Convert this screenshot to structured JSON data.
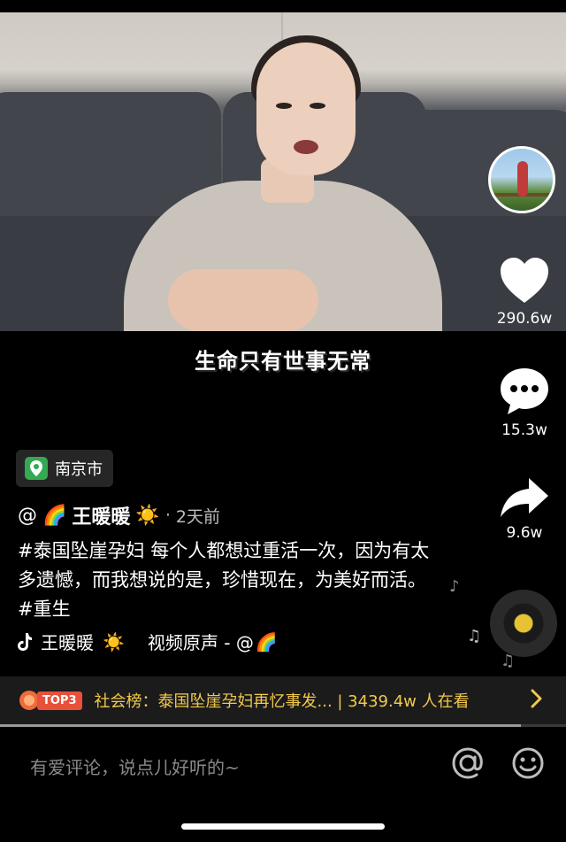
{
  "video": {
    "subtitle": "生命只有世事无常"
  },
  "sidebar": {
    "likes": "290.6w",
    "comments": "15.3w",
    "shares": "9.6w"
  },
  "location": {
    "label": "南京市"
  },
  "post": {
    "author_prefix": "@",
    "author_emoji_before": "🌈",
    "author_name": "王暖暖",
    "author_emoji_after": "☀️",
    "separator": "·",
    "time": "2天前",
    "description": "#泰国坠崖孕妇 每个人都想过重活一次，因为有太多遗憾，而我想说的是，珍惜现在，为美好而活。#重生"
  },
  "music": {
    "creator": "王暖暖",
    "creator_emoji": "☀️",
    "title": "视频原声 - @",
    "title_emoji": "🌈"
  },
  "ranking": {
    "badge": "TOP3",
    "text": "社会榜：泰国坠崖孕妇再忆事发... | 3439.4w 人在看",
    "progress": 0.92
  },
  "comment": {
    "placeholder": "有爱评论，说点儿好听的~"
  },
  "icons": {
    "heart": "heart-icon",
    "comment": "comment-bubble-icon",
    "share": "share-arrow-icon",
    "location": "location-pin-icon",
    "music": "tiktok-note-icon",
    "at": "at-icon",
    "emoji": "smiley-icon"
  },
  "colors": {
    "accent_gold": "#f2c94c",
    "location_green": "#34a853",
    "background": "#000000"
  }
}
